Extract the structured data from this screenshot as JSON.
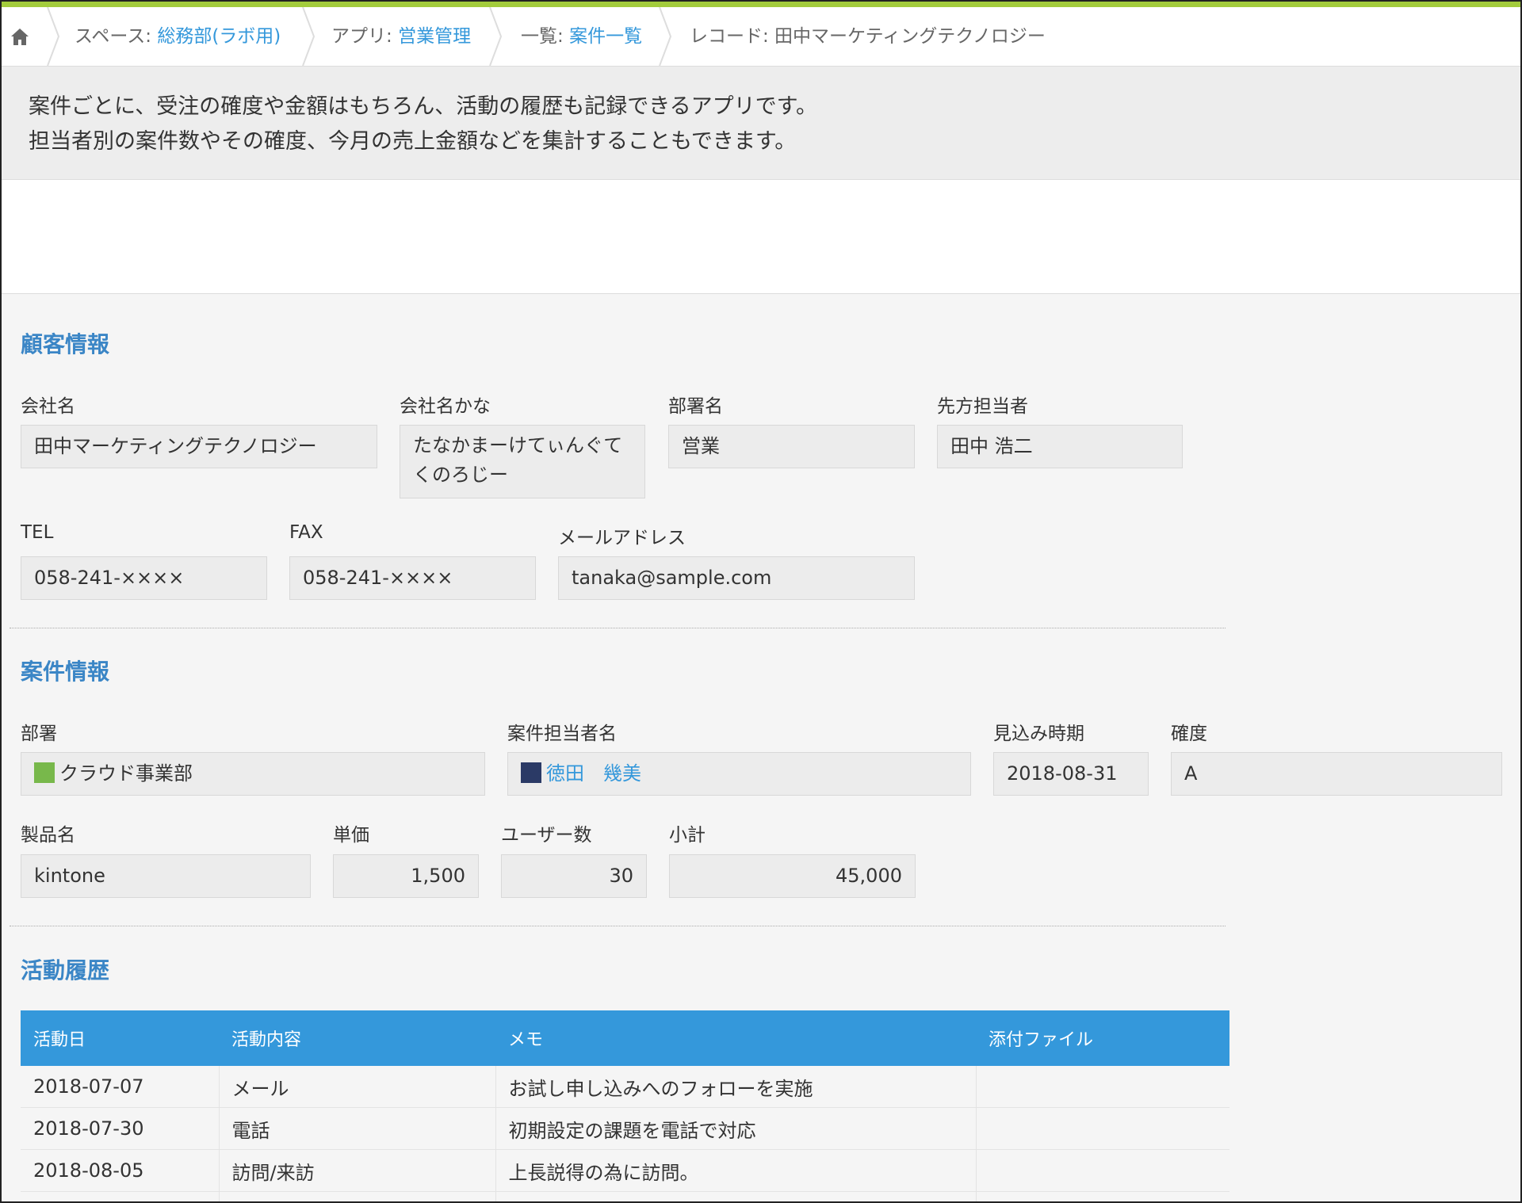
{
  "breadcrumb": {
    "space_prefix": "スペース: ",
    "space_name": "総務部(ラボ用)",
    "app_prefix": "アプリ: ",
    "app_name": "営業管理",
    "list_prefix": "一覧: ",
    "list_name": "案件一覧",
    "record_label": "レコード: 田中マーケティングテクノロジー"
  },
  "description": {
    "line1": "案件ごとに、受注の確度や金額はもちろん、活動の履歴も記録できるアプリです。",
    "line2": "担当者別の案件数やその確度、今月の売上金額などを集計することもできます。"
  },
  "customer_section": {
    "title": "顧客情報",
    "company_label": "会社名",
    "company_value": "田中マーケティングテクノロジー",
    "kana_label": "会社名かな",
    "kana_value": "たなかまーけてぃんぐてくのろじー",
    "dept_label": "部署名",
    "dept_value": "営業",
    "contact_label": "先方担当者",
    "contact_value": "田中 浩二",
    "tel_label": "TEL",
    "tel_value": "058-241-××××",
    "fax_label": "FAX",
    "fax_value": "058-241-××××",
    "email_label": "メールアドレス",
    "email_value": "tanaka@sample.com"
  },
  "deal_section": {
    "title": "案件情報",
    "division_label": "部署",
    "division_value": "クラウド事業部",
    "owner_label": "案件担当者名",
    "owner_value": "徳田　幾美",
    "expected_label": "見込み時期",
    "expected_value": "2018-08-31",
    "certainty_label": "確度",
    "certainty_value": "A",
    "product_label": "製品名",
    "product_value": "kintone",
    "price_label": "単価",
    "price_value": "1,500",
    "users_label": "ユーザー数",
    "users_value": "30",
    "subtotal_label": "小計",
    "subtotal_value": "45,000"
  },
  "activity_section": {
    "title": "活動履歴",
    "columns": [
      "活動日",
      "活動内容",
      "メモ",
      "添付ファイル"
    ],
    "rows": [
      [
        "2018-07-07",
        "メール",
        "お試し申し込みへのフォローを実施",
        ""
      ],
      [
        "2018-07-30",
        "電話",
        "初期設定の課題を電話で対応",
        ""
      ],
      [
        "2018-08-05",
        "訪問/来訪",
        "上長説得の為に訪問。",
        ""
      ]
    ]
  },
  "colors": {
    "accent": "#3498db",
    "section_title": "#3b86c6",
    "top_bar": "#a3cc3c"
  }
}
